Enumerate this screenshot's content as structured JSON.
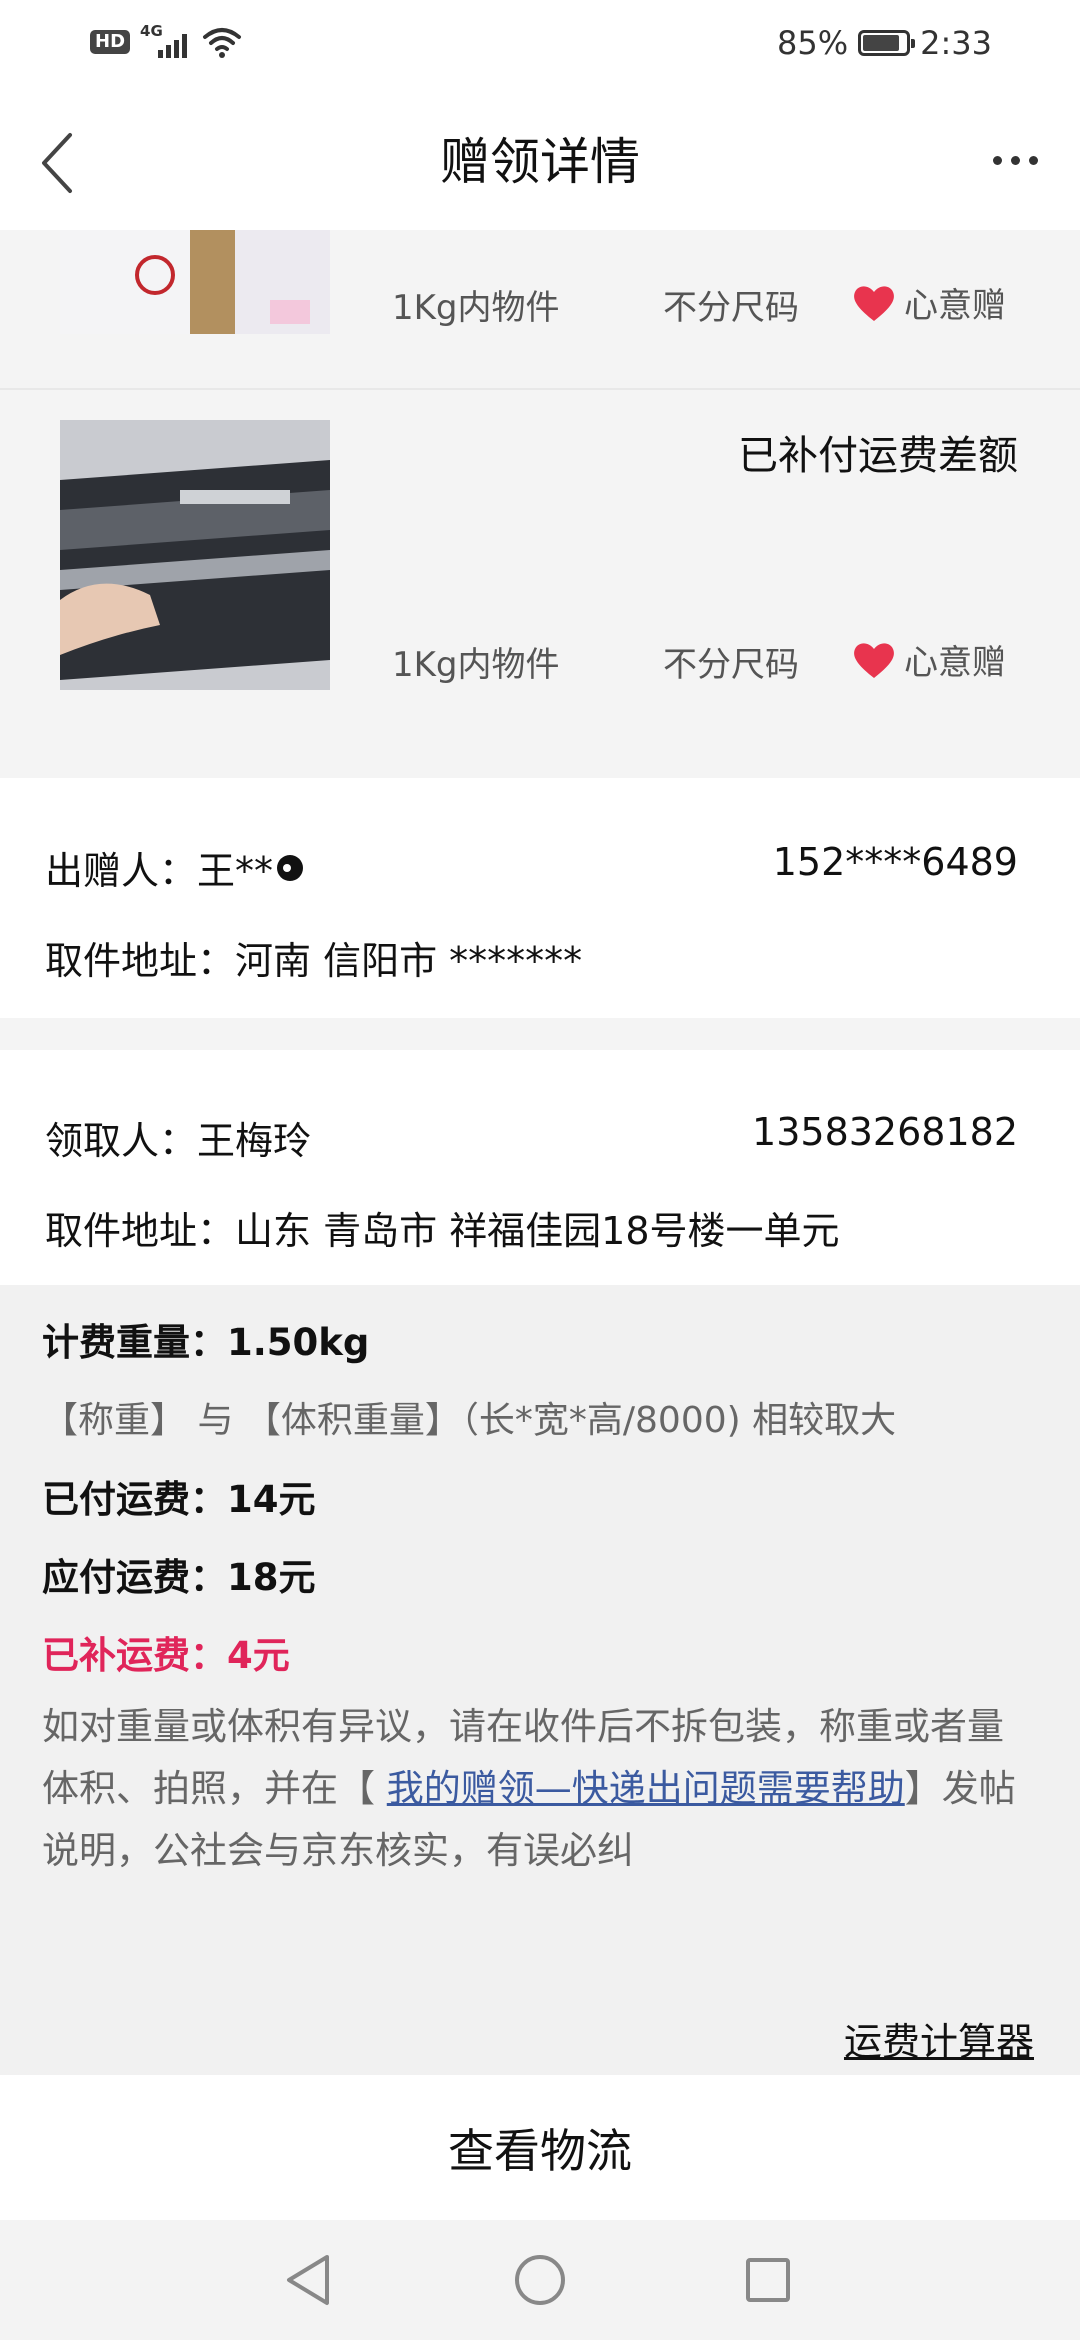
{
  "status_bar": {
    "hd": "HD",
    "network": "4G",
    "battery_percent": "85%",
    "battery_level": 0.85,
    "time": "2:33"
  },
  "header": {
    "title": "赠领详情",
    "back_icon": "chevron-left-icon",
    "more_icon": "more-dots-icon"
  },
  "items": [
    {
      "weight": "1Kg内物件",
      "size": "不分尺码",
      "tag": "心意赠",
      "note": ""
    },
    {
      "weight": "1Kg内物件",
      "size": "不分尺码",
      "tag": "心意赠",
      "note": "已补付运费差额"
    }
  ],
  "giver": {
    "name_label": "出赠人：",
    "name": "王**",
    "phone": "152****6489",
    "address_label": "取件地址：",
    "address": "河南 信阳市 *******"
  },
  "receiver": {
    "name_label": "领取人：",
    "name": "王梅玲",
    "phone": "13583268182",
    "address_label": "取件地址：",
    "address": "山东 青岛市 祥福佳园18号楼一单元"
  },
  "fee": {
    "charged_weight": "计费重量：1.50kg",
    "rule": "【称重】 与 【体积重量】（长*宽*高/8000) 相较取大",
    "paid": "已付运费：14元",
    "due": "应付运费：18元",
    "supplemented": "已补运费：4元",
    "note_before": "如对重量或体积有异议，请在收件后不拆包装，称重或者量体积、拍照，并在【 ",
    "note_link": "我的赠领—快递出问题需要帮助",
    "note_after": "】发帖说明，公社会与京东核实，有误必纠"
  },
  "calculator_link": "运费计算器",
  "bottom_button": "查看物流",
  "colors": {
    "accent_red": "#e0255a",
    "heart": "#e8344e",
    "link_blue": "#3b5aa0"
  }
}
